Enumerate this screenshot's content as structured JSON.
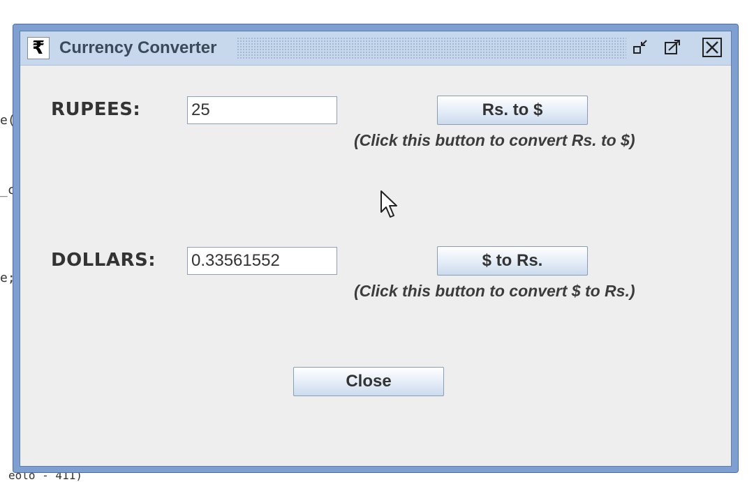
{
  "background_code": {
    "fragments": [
      "e(",
      "_c",
      "e;",
      "eolo - 411)"
    ]
  },
  "window": {
    "title": "Currency Converter",
    "app_icon_glyph": "₹",
    "controls": {
      "minimize_icon": "minimize-icon",
      "maximize_icon": "maximize-icon",
      "close_icon": "close-icon"
    }
  },
  "rupees": {
    "label": "RUPEES:",
    "value": "25",
    "button_label": "Rs. to $",
    "hint": "(Click this button to convert Rs. to $)"
  },
  "dollars": {
    "label": "DOLLARS:",
    "value": "0.33561552",
    "button_label": "$ to Rs.",
    "hint": "(Click this button to convert $ to Rs.)"
  },
  "close_button_label": "Close",
  "colors": {
    "frame": "#7f9fd0",
    "titlebar": "#c8d8ec",
    "panel": "#eeeeee"
  }
}
